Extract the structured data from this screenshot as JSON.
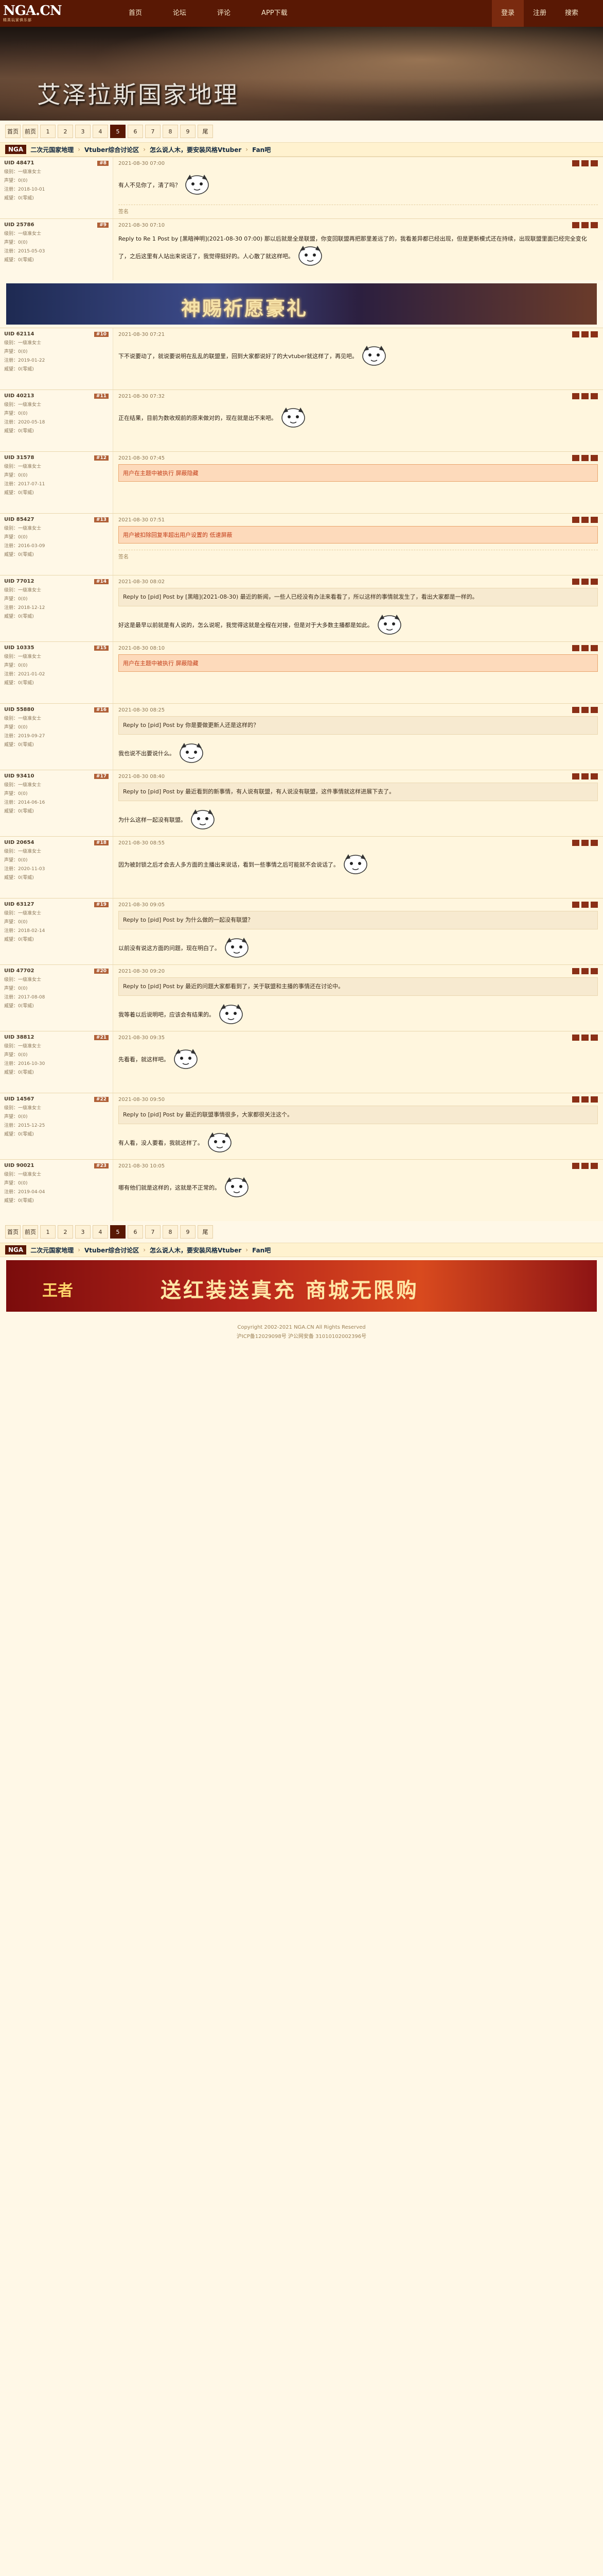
{
  "site": {
    "logo": "NGA.CN",
    "logo_sub": "精英玩家俱乐部",
    "nav": [
      "首页",
      "论坛",
      "评论",
      "APP下载"
    ],
    "user": [
      "登录",
      "注册",
      "搜索"
    ],
    "user_active": 0
  },
  "banner": {
    "title": "艾泽拉斯国家地理"
  },
  "pager": [
    "首页",
    "前页",
    "1",
    "2",
    "3",
    "4",
    "5",
    "6",
    "7",
    "8",
    "9",
    "尾"
  ],
  "pager_current": "5",
  "crumb": {
    "nga": "NGA",
    "items": [
      "二次元国家地理",
      "Vtuber综合讨论区",
      "怎么说人木，要安装风格Vtuber",
      "Fan吧"
    ]
  },
  "ad_top": {
    "text": "神赐祈愿豪礼"
  },
  "posts": [
    {
      "uid": "UID 48471",
      "badge": "",
      "floor": "#8",
      "level": "级别：一级准女士",
      "rep": "声望：0(0)",
      "fav": "注册：2018-10-01",
      "money": "威望：0(零威)",
      "time": "2021-08-30 07:00",
      "content": "有人不见你了，清了吗？",
      "quote": "",
      "hidden": "",
      "sign": "签名"
    },
    {
      "uid": "UID 25786",
      "badge": "",
      "floor": "#9",
      "level": "级别：一级准女士",
      "rep": "声望：0(0)",
      "fav": "注册：2015-05-03",
      "money": "威望：0(零威)",
      "time": "2021-08-30 07:10",
      "content": "Reply to Re 1 Post by [黑暗神明](2021-08-30 07:00) 那以后就是全是联盟，你变回联盟再把那里差远了的，我看差异都已经出现，但是更新模式还在持续，出现联盟里面已经完全变化了，之后这里有人站出来说话了，我觉得挺好的。人心散了就这样吧。",
      "quote": "",
      "hidden": "",
      "sign": ""
    },
    {
      "uid": "UID 62114",
      "badge": "",
      "floor": "#10",
      "level": "级别：一级准女士",
      "rep": "声望：0(0)",
      "fav": "注册：2019-01-22",
      "money": "威望：0(零威)",
      "time": "2021-08-30 07:21",
      "content": "下不说要动了，就说要说明在乱乱的联盟里，回到大家都说好了的大vtuber就这样了，再见吧。",
      "quote": "",
      "hidden": "",
      "sign": ""
    },
    {
      "uid": "UID 40213",
      "badge": "",
      "floor": "#11",
      "level": "级别：一级准女士",
      "rep": "声望：0(0)",
      "fav": "注册：2020-05-18",
      "money": "威望：0(零威)",
      "time": "2021-08-30 07:32",
      "content": "正在结果，目前为数收规前的原来做对的，现在就是出不来吧。",
      "quote": "",
      "hidden": "",
      "sign": ""
    },
    {
      "uid": "UID 31578",
      "badge": "",
      "floor": "#12",
      "level": "级别：一级准女士",
      "rep": "声望：0(0)",
      "fav": "注册：2017-07-11",
      "money": "威望：0(零威)",
      "time": "2021-08-30 07:45",
      "content": "",
      "quote": "",
      "hidden": "用户在主题中被执行 屏蔽隐藏",
      "sign": ""
    },
    {
      "uid": "UID 85427",
      "badge": "",
      "floor": "#13",
      "level": "级别：一级准女士",
      "rep": "声望：0(0)",
      "fav": "注册：2016-03-09",
      "money": "威望：0(零威)",
      "time": "2021-08-30 07:51",
      "content": "",
      "quote": "",
      "hidden": "用户被扣除回复率超出用户设置的 低速屏蔽",
      "sign": "签名"
    },
    {
      "uid": "UID 77012",
      "badge": "",
      "floor": "#14",
      "level": "级别：一级准女士",
      "rep": "声望：0(0)",
      "fav": "注册：2018-12-12",
      "money": "威望：0(零威)",
      "time": "2021-08-30 08:02",
      "content": "好这是最早以前就是有人说的，怎么说呢，我觉得这就是全程在对接，但是对于大多数主播都是如此。",
      "quote": "Reply to [pid] Post by [黑暗](2021-08-30) 最近的新闻，一些人已经没有办法来看看了，所以这样的事情就发生了，看出大家都是一样的。",
      "hidden": "",
      "sign": ""
    },
    {
      "uid": "UID 10335",
      "badge": "",
      "floor": "#15",
      "level": "级别：一级准女士",
      "rep": "声望：0(0)",
      "fav": "注册：2021-01-02",
      "money": "威望：0(零威)",
      "time": "2021-08-30 08:10",
      "content": "",
      "quote": "",
      "hidden": "用户在主题中被执行 屏蔽隐藏",
      "sign": ""
    },
    {
      "uid": "UID 55880",
      "badge": "",
      "floor": "#16",
      "level": "级别：一级准女士",
      "rep": "声望：0(0)",
      "fav": "注册：2019-09-27",
      "money": "威望：0(零威)",
      "time": "2021-08-30 08:25",
      "content": "我也说不出要说什么。",
      "quote": "Reply to [pid] Post by 你是要做更新人还是这样的？",
      "hidden": "",
      "sign": ""
    },
    {
      "uid": "UID 93410",
      "badge": "",
      "floor": "#17",
      "level": "级别：一级准女士",
      "rep": "声望：0(0)",
      "fav": "注册：2014-06-16",
      "money": "威望：0(零威)",
      "time": "2021-08-30 08:40",
      "content": "为什么这样一起没有联盟。",
      "quote": "Reply to [pid] Post by 最近看到的新事情，有人说有联盟，有人说没有联盟，这件事情就这样进展下去了。",
      "hidden": "",
      "sign": ""
    },
    {
      "uid": "UID 20654",
      "badge": "",
      "floor": "#18",
      "level": "级别：一级准女士",
      "rep": "声望：0(0)",
      "fav": "注册：2020-11-03",
      "money": "威望：0(零威)",
      "time": "2021-08-30 08:55",
      "content": "因为被封锁之后才会去人多方面的主播出来说话，看到一些事情之后可能就不会说话了。",
      "quote": "",
      "hidden": "",
      "sign": ""
    },
    {
      "uid": "UID 63127",
      "badge": "",
      "floor": "#19",
      "level": "级别：一级准女士",
      "rep": "声望：0(0)",
      "fav": "注册：2018-02-14",
      "money": "威望：0(零威)",
      "time": "2021-08-30 09:05",
      "content": "以前没有说这方面的问题，现在明白了。",
      "quote": "Reply to [pid] Post by 为什么做的一起没有联盟？",
      "hidden": "",
      "sign": ""
    },
    {
      "uid": "UID 47702",
      "badge": "",
      "floor": "#20",
      "level": "级别：一级准女士",
      "rep": "声望：0(0)",
      "fav": "注册：2017-08-08",
      "money": "威望：0(零威)",
      "time": "2021-08-30 09:20",
      "content": "我等着以后说明吧，应该会有结果的。",
      "quote": "Reply to [pid] Post by 最近的问题大家都看到了，关于联盟和主播的事情还在讨论中。",
      "hidden": "",
      "sign": ""
    },
    {
      "uid": "UID 38812",
      "badge": "",
      "floor": "#21",
      "level": "级别：一级准女士",
      "rep": "声望：0(0)",
      "fav": "注册：2016-10-30",
      "money": "威望：0(零威)",
      "time": "2021-08-30 09:35",
      "content": "先看看，就这样吧。",
      "quote": "",
      "hidden": "",
      "sign": ""
    },
    {
      "uid": "UID 14567",
      "badge": "",
      "floor": "#22",
      "level": "级别：一级准女士",
      "rep": "声望：0(0)",
      "fav": "注册：2015-12-25",
      "money": "威望：0(零威)",
      "time": "2021-08-30 09:50",
      "content": "有人看，没人要看，我就这样了。",
      "quote": "Reply to [pid] Post by 最近的联盟事情很多，大家都很关注这个。",
      "hidden": "",
      "sign": ""
    },
    {
      "uid": "UID 90021",
      "badge": "",
      "floor": "#23",
      "level": "级别：一级准女士",
      "rep": "声望：0(0)",
      "fav": "注册：2019-04-04",
      "money": "威望：0(零威)",
      "time": "2021-08-30 10:05",
      "content": "哪有他们就是这样的，这就是不正常的。",
      "quote": "",
      "hidden": "",
      "sign": ""
    }
  ],
  "ad_bottom": {
    "title": "送红装送真充",
    "sub": "商城无限购",
    "brand": "王者"
  },
  "footer": [
    "Copyright 2002-2021 NGA.CN All Rights Reserved",
    "沪ICP备12029098号 沪公网安备 31010102002396号"
  ]
}
